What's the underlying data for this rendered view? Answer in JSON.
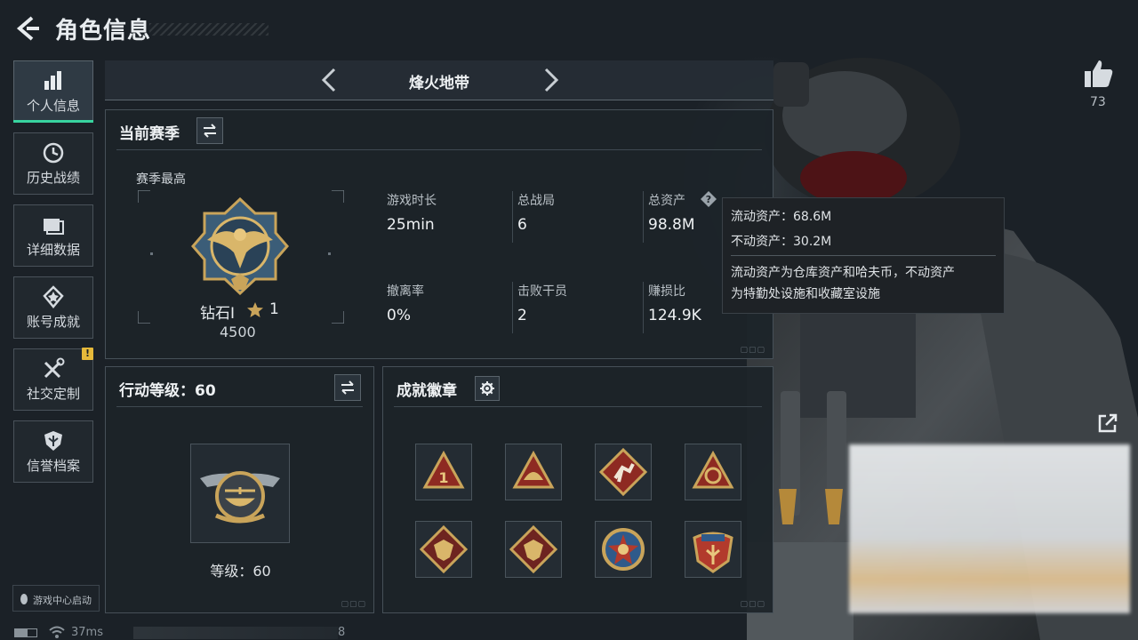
{
  "header": {
    "title": "角色信息"
  },
  "sidebar": {
    "items": [
      {
        "label": "个人信息",
        "icon": "bar-chart-icon",
        "active": true
      },
      {
        "label": "历史战绩",
        "icon": "clock-history-icon"
      },
      {
        "label": "详细数据",
        "icon": "folder-icon"
      },
      {
        "label": "账号成就",
        "icon": "achievement-medal-icon"
      },
      {
        "label": "社交定制",
        "icon": "wrench-tools-icon",
        "badge": "!"
      },
      {
        "label": "信誉档案",
        "icon": "shield-icon"
      }
    ],
    "game_center_label": "游戏中心启动"
  },
  "mode": {
    "title": "烽火地带"
  },
  "season": {
    "title": "当前赛季",
    "best_label": "赛季最高",
    "rank_name": "钻石I",
    "rank_level": "1",
    "rank_points": "4500",
    "stats": [
      {
        "label": "游戏时长",
        "value": "25min"
      },
      {
        "label": "总战局",
        "value": "6"
      },
      {
        "label": "总资产",
        "value": "98.8M"
      },
      {
        "label": "撤离率",
        "value": "0%"
      },
      {
        "label": "击败干员",
        "value": "2"
      },
      {
        "label": "赚损比",
        "value": "124.9K"
      }
    ]
  },
  "tooltip": {
    "liquid": "流动资产：68.6M",
    "fixed": "不动资产：30.2M",
    "desc_line1": "流动资产为仓库资产和哈夫币，不动资产",
    "desc_line2": "为特勤处设施和收藏室设施"
  },
  "action_level": {
    "title": "行动等级：60",
    "level_label": "等级：60"
  },
  "badges": {
    "title": "成就徽章",
    "items": [
      "rank-one-triangle-badge",
      "helmet-triangle-badge",
      "runner-diamond-badge",
      "globe-triangle-badge",
      "dragon-diamond-badge",
      "dragon-diamond-badge-2",
      "star-medal-badge",
      "shield-eagle-badge"
    ]
  },
  "social": {
    "like_count": "73"
  },
  "status": {
    "ping": "37ms",
    "tail": "8"
  },
  "colors": {
    "accent": "#38d39f",
    "warn": "#e6b93a",
    "gold": "#c9a45a",
    "badge_red": "#8e2a22"
  }
}
